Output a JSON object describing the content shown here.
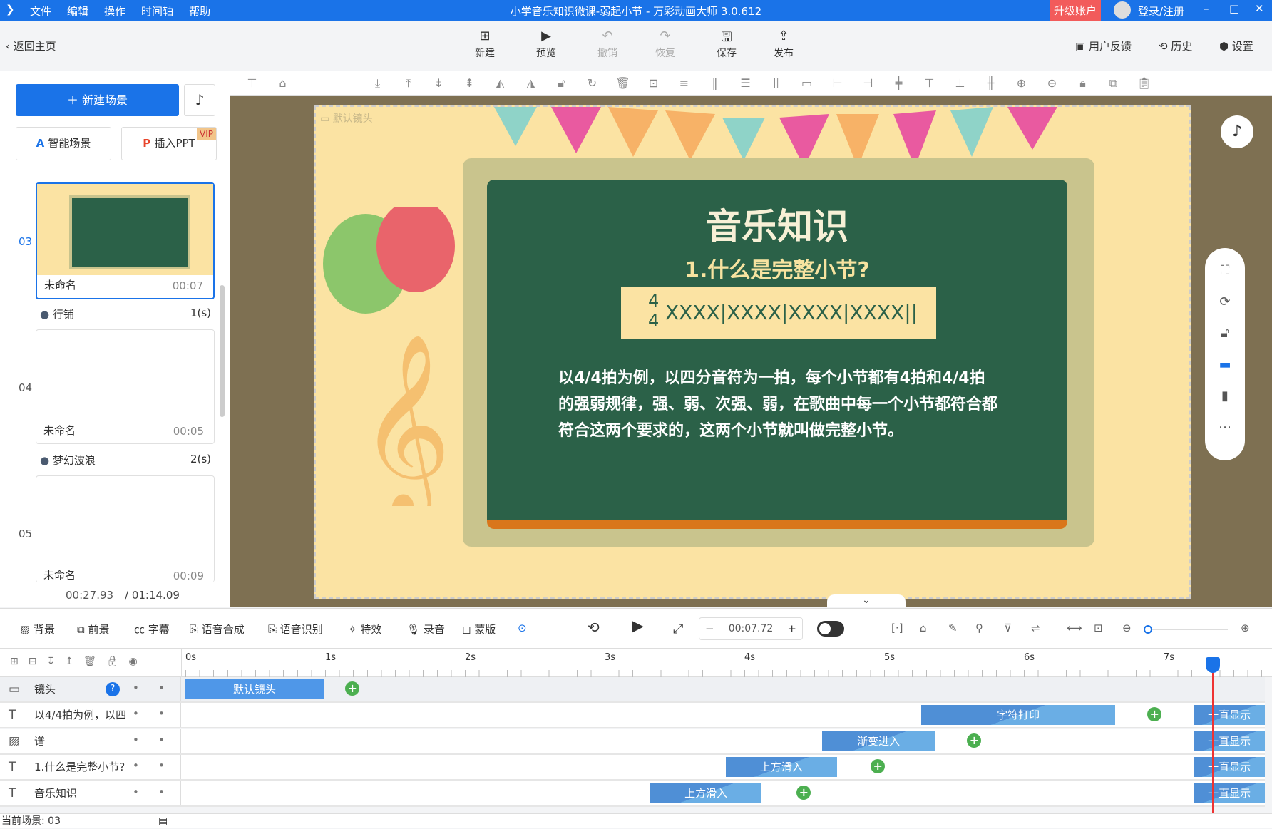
{
  "window": {
    "title": "小学音乐知识微课-弱起小节 - 万彩动画大师 3.0.612",
    "upgrade": "升级账户",
    "login": "登录/注册",
    "menu": [
      "文件",
      "编辑",
      "操作",
      "时间轴",
      "帮助"
    ]
  },
  "toolbar": {
    "back": "返回主页",
    "buttons": [
      "新建",
      "预览",
      "撤销",
      "恢复",
      "保存",
      "发布"
    ],
    "feedback": "用户反馈",
    "history": "历史",
    "settings": "设置"
  },
  "left": {
    "new_scene": "新建场景",
    "smart_scene": "智能场景",
    "insert_ppt": "插入PPT",
    "vip": "VIP",
    "scenes": [
      {
        "num": "03",
        "name": "未命名",
        "time": "00:07"
      },
      {
        "num": "04",
        "name": "未命名",
        "time": "00:05"
      },
      {
        "num": "05",
        "name": "未命名",
        "time": "00:09"
      }
    ],
    "transitions": [
      {
        "name": "行铺",
        "dur": "1(s)"
      },
      {
        "name": "梦幻波浪",
        "dur": "2(s)"
      }
    ],
    "current_time": "00:27.93",
    "total_time": "/ 01:14.09"
  },
  "slide": {
    "camera_label": "默认镜头",
    "title": "音乐知识",
    "subtitle": "1.什么是完整小节?",
    "time_sig_top": "4",
    "time_sig_bottom": "4",
    "notation": "XXXX|XXXX|XXXX|XXXX||",
    "body": "以4/4拍为例，以四分音符为一拍，每个小节都有4拍和4/4拍的强弱规律，强、弱、次强、弱，在歌曲中每一个小节都符合都符合这两个要求的，这两个小节就叫做完整小节。"
  },
  "bottom": {
    "tools": [
      "背景",
      "前景",
      "字幕",
      "语音合成",
      "语音识别",
      "特效",
      "录音",
      "蒙版"
    ],
    "time": "00:07.72"
  },
  "timeline": {
    "ticks": [
      "0s",
      "1s",
      "2s",
      "3s",
      "4s",
      "5s",
      "6s",
      "7s"
    ],
    "rows": [
      {
        "icon": "camera",
        "label": "镜头",
        "clips": [
          {
            "label": "默认镜头",
            "start": 0,
            "end": 1
          }
        ],
        "kf": 1.2
      },
      {
        "icon": "T",
        "label": "以4/4拍为例，以四",
        "clips": [
          {
            "label": "字符打印",
            "start": 5.27,
            "end": 6.66
          },
          {
            "label": "一直显示",
            "start": 7.22,
            "end": 7.73
          }
        ],
        "kf": 6.94
      },
      {
        "icon": "image",
        "label": "谱",
        "clips": [
          {
            "label": "渐变进入",
            "start": 4.56,
            "end": 5.37
          },
          {
            "label": "一直显示",
            "start": 7.22,
            "end": 7.73
          }
        ],
        "kf": 5.65
      },
      {
        "icon": "T",
        "label": "1.什么是完整小节?",
        "clips": [
          {
            "label": "上方滑入",
            "start": 3.87,
            "end": 4.67
          },
          {
            "label": "一直显示",
            "start": 7.22,
            "end": 7.73
          }
        ],
        "kf": 4.96
      },
      {
        "icon": "T",
        "label": "音乐知识",
        "clips": [
          {
            "label": "上方滑入",
            "start": 3.33,
            "end": 4.13
          },
          {
            "label": "一直显示",
            "start": 7.22,
            "end": 7.73
          }
        ],
        "kf": 4.43
      }
    ],
    "playhead": 7.35
  },
  "status": {
    "current_scene": "当前场景: 03"
  }
}
